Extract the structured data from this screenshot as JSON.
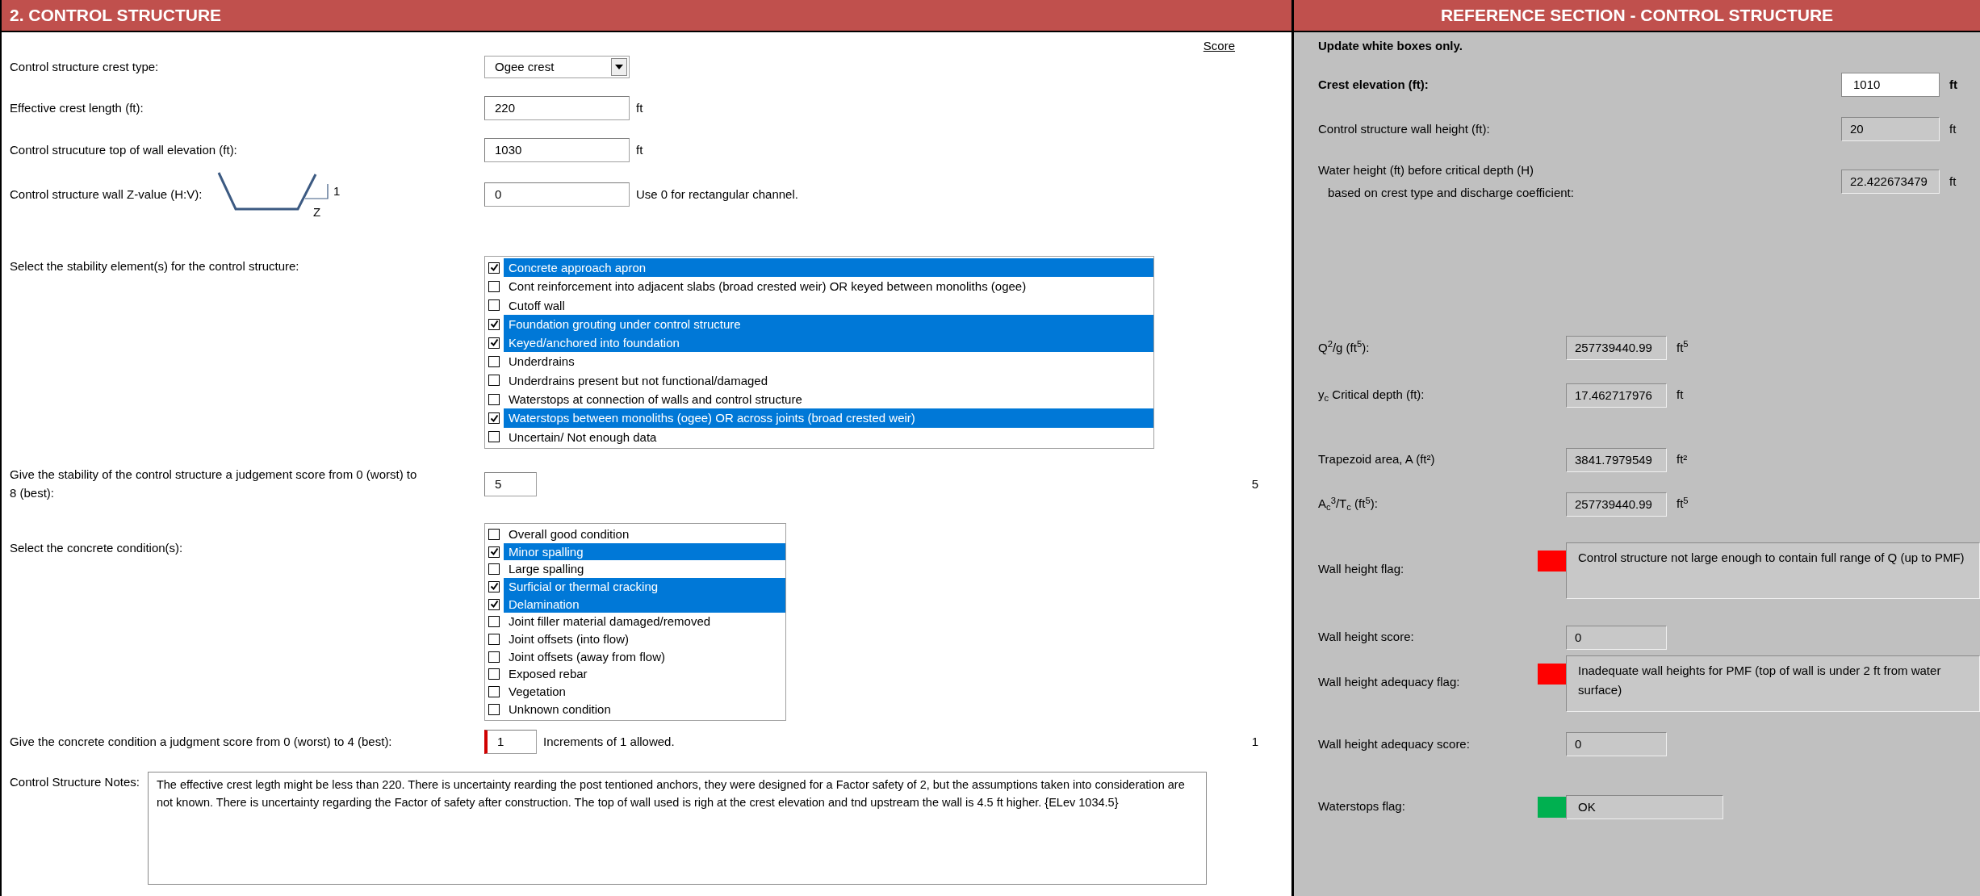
{
  "form": {
    "title": "2. CONTROL STRUCTURE",
    "score_heading": "Score",
    "rows": [
      {
        "kind": "dropdown",
        "label": "Control structure crest type:",
        "value": "Ogee crest"
      },
      {
        "kind": "input",
        "label": "Effective crest length (ft):",
        "value": "220",
        "unit": "ft"
      },
      {
        "kind": "input",
        "label": "Control strucuture top of wall elevation (ft):",
        "value": "1030",
        "unit": "ft"
      },
      {
        "kind": "zvalue",
        "label": "Control structure wall Z-value (H:V):",
        "rise_label": "1",
        "run_label": "Z",
        "value": "0",
        "note": "Use 0 for rectangular channel."
      },
      {
        "kind": "checklist",
        "label": "Select the stability element(s) for the control structure:",
        "options": [
          {
            "label": "Concrete approach apron",
            "checked": true
          },
          {
            "label": "Cont reinforcement into adjacent slabs (broad crested weir) OR keyed between monoliths (ogee)",
            "checked": false
          },
          {
            "label": "Cutoff wall",
            "checked": false
          },
          {
            "label": "Foundation grouting under control structure",
            "checked": true
          },
          {
            "label": "Keyed/anchored into foundation",
            "checked": true
          },
          {
            "label": "Underdrains",
            "checked": false
          },
          {
            "label": "Underdrains present but not functional/damaged",
            "checked": false
          },
          {
            "label": "Waterstops at connection of walls and control structure",
            "checked": false
          },
          {
            "label": "Waterstops between monoliths (ogee) OR across joints (broad crested weir)",
            "checked": true
          },
          {
            "label": "Uncertain/ Not enough data",
            "checked": false
          }
        ]
      },
      {
        "kind": "score",
        "label": "Give the stability of the control structure a judgement score from 0 (worst) to 8 (best):",
        "value": "5",
        "score": "5",
        "marked": false
      },
      {
        "kind": "checklist",
        "label": "Select the concrete condition(s):",
        "options": [
          {
            "label": "Overall good condition",
            "checked": false
          },
          {
            "label": "Minor spalling",
            "checked": true
          },
          {
            "label": "Large spalling",
            "checked": false
          },
          {
            "label": "Surficial or thermal cracking",
            "checked": true
          },
          {
            "label": "Delamination",
            "checked": true
          },
          {
            "label": "Joint filler material damaged/removed",
            "checked": false
          },
          {
            "label": "Joint offsets (into flow)",
            "checked": false
          },
          {
            "label": "Joint offsets (away from flow)",
            "checked": false
          },
          {
            "label": "Exposed rebar",
            "checked": false
          },
          {
            "label": "Vegetation",
            "checked": false
          },
          {
            "label": "Unknown condition",
            "checked": false
          }
        ]
      },
      {
        "kind": "score",
        "label": "Give the concrete condition a judgment score from 0 (worst) to 4 (best):",
        "value": "1",
        "note": "Increments of 1 allowed.",
        "score": "1",
        "marked": true
      },
      {
        "kind": "notes",
        "label": "Control Structure Notes:",
        "value": "The effective crest legth might be less than 220. There is uncertainty rearding the post tentioned anchors, they were designed for a Factor safety of 2, but the assumptions taken into consideration are not known. There is uncertainty regarding the Factor of safety after construction. The top of wall used is righ at the crest elevation and tnd upstream the wall is 4.5 ft higher. {ELev 1034.5}"
      }
    ]
  },
  "reference": {
    "title": "REFERENCE SECTION - CONTROL STRUCTURE",
    "instruction": "Update white boxes only.",
    "rows": [
      {
        "kind": "entry",
        "label": "Crest elevation (ft):",
        "value": "1010",
        "unit": "ft"
      },
      {
        "kind": "result",
        "label": "Control structure wall height (ft):",
        "value": "20",
        "unit": "ft"
      },
      {
        "kind": "result",
        "label": "Water height (ft) before critical depth (H)",
        "label_line_2": "based on crest type and discharge coefficient:",
        "value": "22.422673479",
        "unit": "ft"
      },
      {
        "kind": "computed",
        "label": "Q$^{2}$/g (ft$^{5}$):",
        "value": "257739440.99",
        "unit": "ft$^{5}$"
      },
      {
        "kind": "computed",
        "label": "y$_{c}$ Critical depth (ft):",
        "value": "17.462717976",
        "unit": "ft"
      },
      {
        "kind": "computed",
        "label": "Trapezoid area, A (ft²)",
        "value": "3841.7979549",
        "unit": "ft²"
      },
      {
        "kind": "computed",
        "label": "A$_{c}$$^{3}$/T$_{c}$ (ft$^{5}$):",
        "value": "257739440.99",
        "unit": "ft$^{5}$"
      },
      {
        "kind": "flag",
        "label": "Wall height flag:",
        "color": "#ff0000",
        "value": "Control structure not large enough to contain full range of Q (up to PMF)"
      },
      {
        "kind": "computed",
        "label": "Wall height score:",
        "value": "0"
      },
      {
        "kind": "flag",
        "label": "Wall height adequacy flag:",
        "color": "#ff0000",
        "value": "Inadequate wall heights for PMF (top of wall is under 2 ft from water surface)"
      },
      {
        "kind": "computed",
        "label": "Wall height adequacy score:",
        "value": "0"
      },
      {
        "kind": "status",
        "label": "Waterstops flag:",
        "color": "#00b050",
        "value": "OK"
      }
    ]
  }
}
